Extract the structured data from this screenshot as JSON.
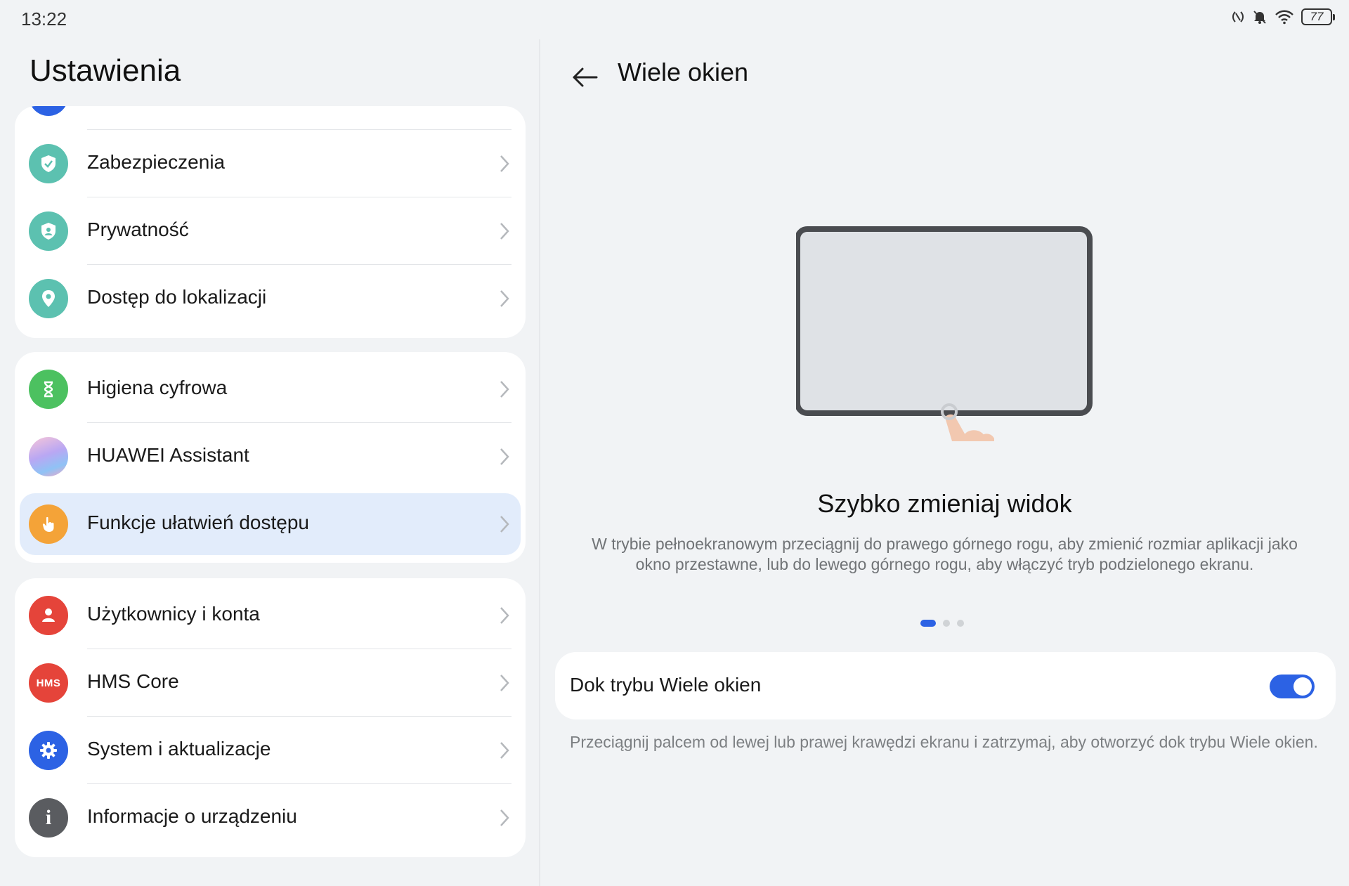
{
  "status_bar": {
    "time": "13:22",
    "battery": "77"
  },
  "left": {
    "title": "Ustawienia",
    "group1": [
      {
        "label": "Zabezpieczenia",
        "icon": "shield-icon",
        "color": "#5cc1b0"
      },
      {
        "label": "Prywatność",
        "icon": "privacy-icon",
        "color": "#5cc1b0"
      },
      {
        "label": "Dostęp do lokalizacji",
        "icon": "location-pin-icon",
        "color": "#5cc1b0"
      }
    ],
    "group2": [
      {
        "label": "Higiena cyfrowa",
        "icon": "hourglass-icon",
        "color": "#4cc160"
      },
      {
        "label": "HUAWEI Assistant",
        "icon": "assistant-orb-icon",
        "color": "#a5a8f6"
      },
      {
        "label": "Funkcje ułatwień dostępu",
        "icon": "hand-icon",
        "color": "#f4a338",
        "selected": true
      }
    ],
    "group3": [
      {
        "label": "Użytkownicy i konta",
        "icon": "user-icon",
        "color": "#e5443a"
      },
      {
        "label": "HMS Core",
        "icon": "hms-icon",
        "icon_text": "HMS",
        "color": "#e5443a"
      },
      {
        "label": "System i aktualizacje",
        "icon": "gear-icon",
        "color": "#2c62e4"
      },
      {
        "label": "Informacje o urządzeniu",
        "icon": "info-icon",
        "icon_text": "i",
        "color": "#5a5c60"
      }
    ]
  },
  "right": {
    "title": "Wiele okien",
    "slide_title": "Szybko zmieniaj widok",
    "slide_desc": "W trybie pełnoekranowym przeciągnij do prawego górnego rogu, aby zmienić rozmiar aplikacji jako okno przestawne, lub do lewego górnego rogu, aby włączyć tryb podzielonego ekranu.",
    "dots_total": 3,
    "dots_active": 1,
    "toggle_label": "Dok trybu Wiele okien",
    "toggle_on": true,
    "hint": "Przeciągnij palcem od lewej lub prawej krawędzi ekranu i zatrzymaj, aby otworzyć dok trybu Wiele okien."
  },
  "colors": {
    "accent": "#2c62e4",
    "selected_bg": "#e2ecfb",
    "background": "#f1f3f5"
  }
}
